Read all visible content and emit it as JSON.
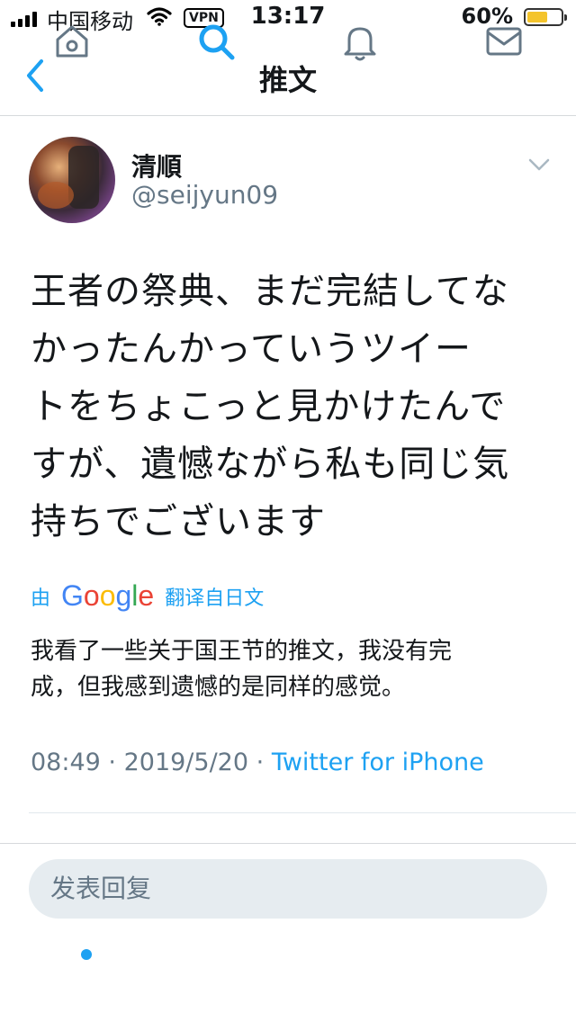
{
  "status_bar": {
    "carrier": "中国移动",
    "vpn": "VPN",
    "time": "13:17",
    "battery_percent": "60%",
    "battery_level": 0.6,
    "signal_icon": "signal-bars-icon",
    "wifi_icon": "wifi-icon"
  },
  "nav": {
    "title": "推文",
    "back_icon": "chevron-left-icon"
  },
  "tweet": {
    "display_name": "清順",
    "handle": "@seijyun09",
    "text_lines": [
      "王者の祭典、まだ完結してな",
      "かったんかっていうツイー",
      "トをちょこっと見かけたんで",
      "すが、遺憾ながら私も同じ気",
      "持ちでございます"
    ],
    "translate_prefix": "由",
    "translate_brand": "Google",
    "translate_suffix": "翻译自日文",
    "translation_lines": [
      "我看了一些关于国王节的推文，我没有完",
      "成，但我感到遗憾的是同样的感觉。"
    ],
    "time": "08:49",
    "separator": "·",
    "date": "2019/5/20",
    "source": "Twitter for iPhone"
  },
  "reply": {
    "placeholder": "发表回复"
  },
  "tabs": {
    "home_icon": "home-icon",
    "search_icon": "search-icon",
    "notifications_icon": "bell-icon",
    "messages_icon": "envelope-icon"
  },
  "colors": {
    "accent": "#1da1f2",
    "secondary_text": "#657786",
    "battery": "#f4c42c"
  }
}
